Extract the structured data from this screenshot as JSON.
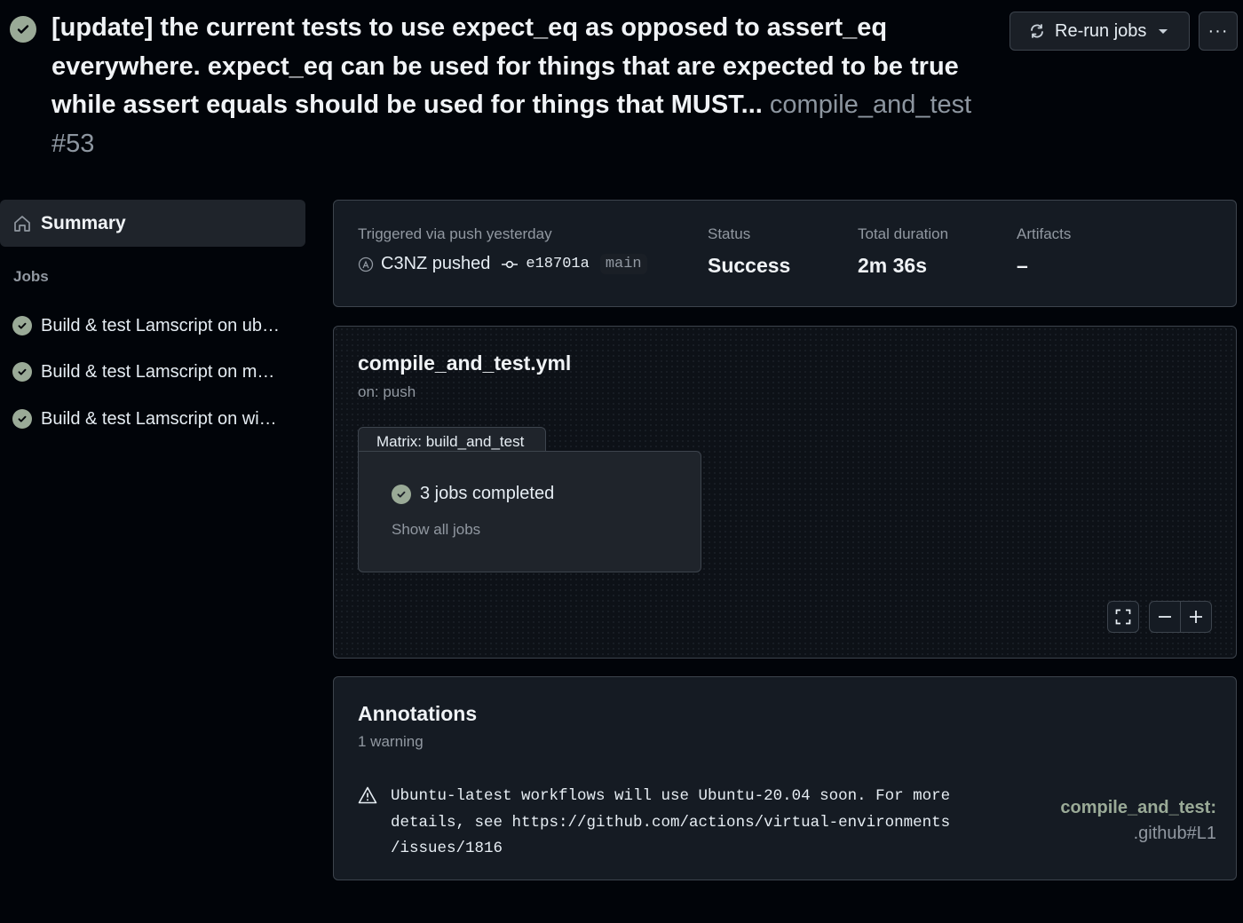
{
  "header": {
    "title": "[update] the current tests to use expect_eq as opposed to assert_eq everywhere. expect_eq can be used for things that are expected to be true while assert equals should be used for things that MUST...",
    "workflow": "compile_and_test",
    "run_number": "#53",
    "rerun_label": "Re-run jobs",
    "more_label": "···"
  },
  "sidebar": {
    "summary_label": "Summary",
    "jobs_heading": "Jobs",
    "jobs": [
      {
        "label": "Build & test Lamscript on ub…"
      },
      {
        "label": "Build & test Lamscript on m…"
      },
      {
        "label": "Build & test Lamscript on wi…"
      }
    ]
  },
  "info": {
    "trigger_label": "Triggered via push yesterday",
    "actor": "C3NZ pushed",
    "commit": "e18701a",
    "branch": "main",
    "status_label": "Status",
    "status_value": "Success",
    "duration_label": "Total duration",
    "duration_value": "2m 36s",
    "artifacts_label": "Artifacts",
    "artifacts_value": "–"
  },
  "graph": {
    "workflow_file": "compile_and_test.yml",
    "trigger": "on: push",
    "matrix_label": "Matrix: build_and_test",
    "matrix_status": "3 jobs completed",
    "show_all": "Show all jobs"
  },
  "annotations": {
    "title": "Annotations",
    "count": "1 warning",
    "items": [
      {
        "message": "Ubuntu-latest workflows will use Ubuntu-20.04 soon. For more\ndetails, see https://github.com/actions/virtual-environments\n/issues/1816",
        "file": "compile_and_test:",
        "line": ".github#L1"
      }
    ]
  },
  "colors": {
    "background": "#010409",
    "success": "#9aaa97",
    "border": "#3d444d"
  }
}
